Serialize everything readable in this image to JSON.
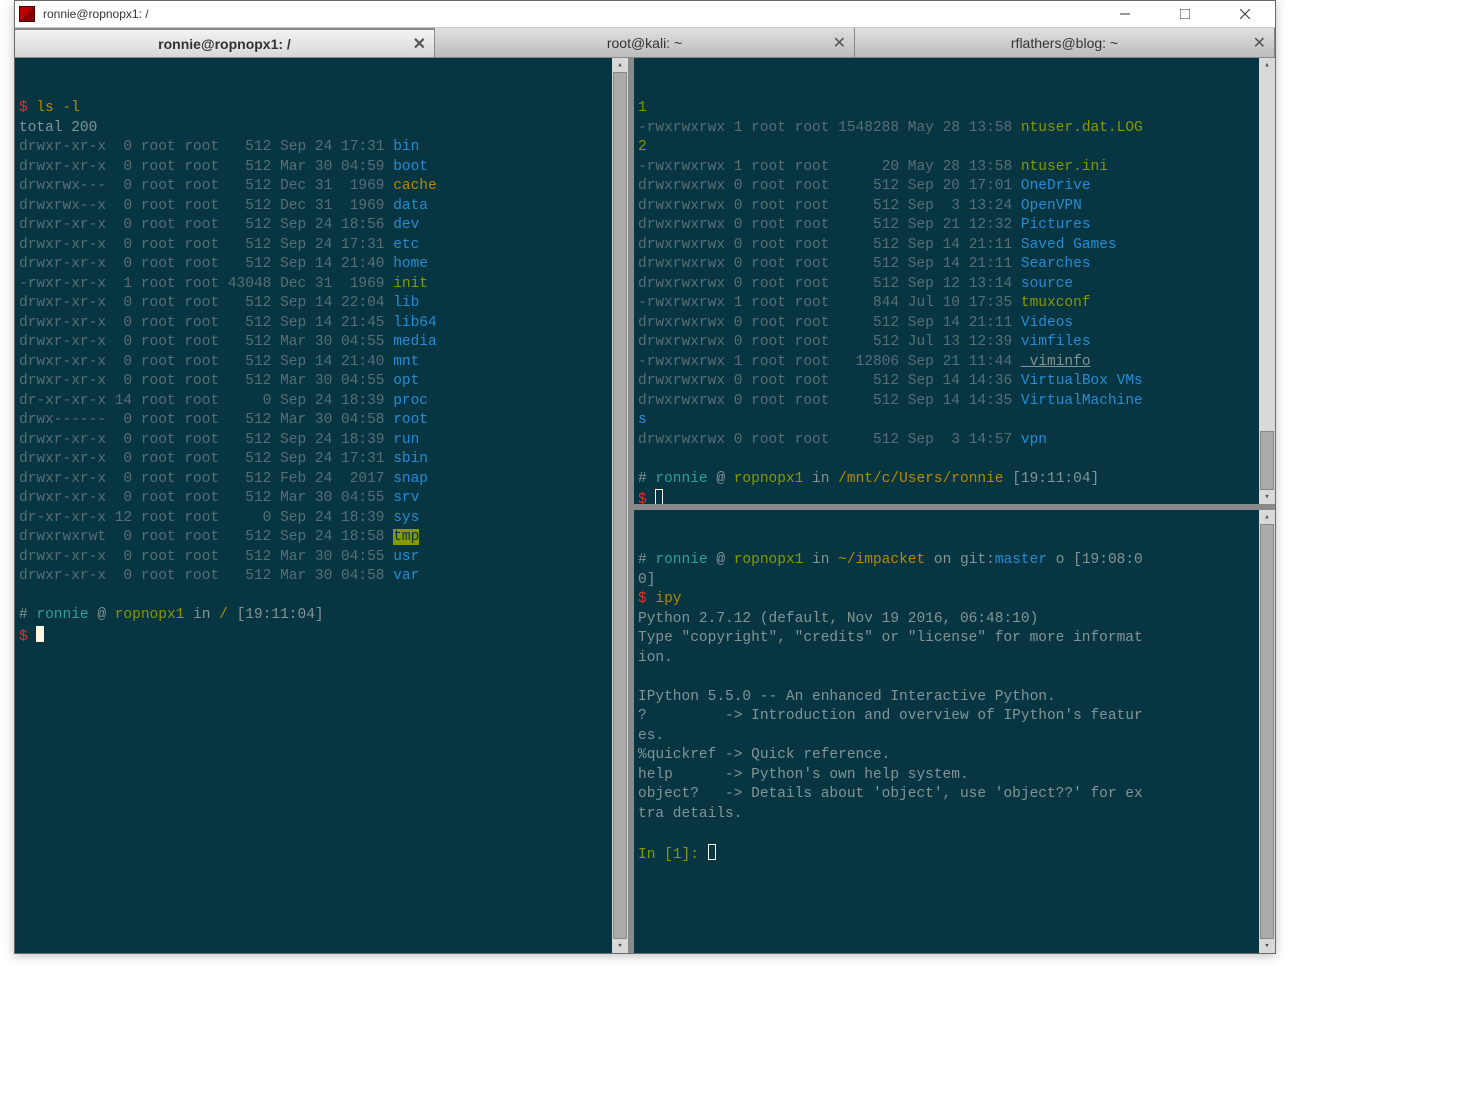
{
  "window": {
    "title": "ronnie@ropnopx1: /"
  },
  "tabs": [
    {
      "label": "ronnie@ropnopx1: /",
      "active": true
    },
    {
      "label": "root@kali: ~",
      "active": false
    },
    {
      "label": "rflathers@blog: ~",
      "active": false
    }
  ],
  "left_pane": {
    "cmd_prompt": "$",
    "cmd": "ls -l",
    "total": "total 200",
    "rows": [
      {
        "perm": "drwxr-xr-x",
        "n": " 0",
        "own": "root root",
        "size": "  512",
        "date": "Sep 24 17:31",
        "name": "bin",
        "cls": "c-dir"
      },
      {
        "perm": "drwxr-xr-x",
        "n": " 0",
        "own": "root root",
        "size": "  512",
        "date": "Mar 30 04:59",
        "name": "boot",
        "cls": "c-dir"
      },
      {
        "perm": "drwxrwx---",
        "n": " 0",
        "own": "root root",
        "size": "  512",
        "date": "Dec 31  1969",
        "name": "cache",
        "cls": "c-cmd"
      },
      {
        "perm": "drwxrwx--x",
        "n": " 0",
        "own": "root root",
        "size": "  512",
        "date": "Dec 31  1969",
        "name": "data",
        "cls": "c-dir"
      },
      {
        "perm": "drwxr-xr-x",
        "n": " 0",
        "own": "root root",
        "size": "  512",
        "date": "Sep 24 18:56",
        "name": "dev",
        "cls": "c-dir"
      },
      {
        "perm": "drwxr-xr-x",
        "n": " 0",
        "own": "root root",
        "size": "  512",
        "date": "Sep 24 17:31",
        "name": "etc",
        "cls": "c-dir"
      },
      {
        "perm": "drwxr-xr-x",
        "n": " 0",
        "own": "root root",
        "size": "  512",
        "date": "Sep 14 21:40",
        "name": "home",
        "cls": "c-dir"
      },
      {
        "perm": "-rwxr-xr-x",
        "n": " 1",
        "own": "root root",
        "size": "43048",
        "date": "Dec 31  1969",
        "name": "init",
        "cls": "c-exec"
      },
      {
        "perm": "drwxr-xr-x",
        "n": " 0",
        "own": "root root",
        "size": "  512",
        "date": "Sep 14 22:04",
        "name": "lib",
        "cls": "c-dir"
      },
      {
        "perm": "drwxr-xr-x",
        "n": " 0",
        "own": "root root",
        "size": "  512",
        "date": "Sep 14 21:45",
        "name": "lib64",
        "cls": "c-dir"
      },
      {
        "perm": "drwxr-xr-x",
        "n": " 0",
        "own": "root root",
        "size": "  512",
        "date": "Mar 30 04:55",
        "name": "media",
        "cls": "c-dir"
      },
      {
        "perm": "drwxr-xr-x",
        "n": " 0",
        "own": "root root",
        "size": "  512",
        "date": "Sep 14 21:40",
        "name": "mnt",
        "cls": "c-dir"
      },
      {
        "perm": "drwxr-xr-x",
        "n": " 0",
        "own": "root root",
        "size": "  512",
        "date": "Mar 30 04:55",
        "name": "opt",
        "cls": "c-dir"
      },
      {
        "perm": "dr-xr-xr-x",
        "n": "14",
        "own": "root root",
        "size": "    0",
        "date": "Sep 24 18:39",
        "name": "proc",
        "cls": "c-dir"
      },
      {
        "perm": "drwx------",
        "n": " 0",
        "own": "root root",
        "size": "  512",
        "date": "Mar 30 04:58",
        "name": "root",
        "cls": "c-dir"
      },
      {
        "perm": "drwxr-xr-x",
        "n": " 0",
        "own": "root root",
        "size": "  512",
        "date": "Sep 24 18:39",
        "name": "run",
        "cls": "c-dir"
      },
      {
        "perm": "drwxr-xr-x",
        "n": " 0",
        "own": "root root",
        "size": "  512",
        "date": "Sep 24 17:31",
        "name": "sbin",
        "cls": "c-dir"
      },
      {
        "perm": "drwxr-xr-x",
        "n": " 0",
        "own": "root root",
        "size": "  512",
        "date": "Feb 24  2017",
        "name": "snap",
        "cls": "c-dir"
      },
      {
        "perm": "drwxr-xr-x",
        "n": " 0",
        "own": "root root",
        "size": "  512",
        "date": "Mar 30 04:55",
        "name": "srv",
        "cls": "c-dir"
      },
      {
        "perm": "dr-xr-xr-x",
        "n": "12",
        "own": "root root",
        "size": "    0",
        "date": "Sep 24 18:39",
        "name": "sys",
        "cls": "c-dir"
      },
      {
        "perm": "drwxrwxrwt",
        "n": " 0",
        "own": "root root",
        "size": "  512",
        "date": "Sep 24 18:58",
        "name": "tmp",
        "cls": "c-hl"
      },
      {
        "perm": "drwxr-xr-x",
        "n": " 0",
        "own": "root root",
        "size": "  512",
        "date": "Mar 30 04:55",
        "name": "usr",
        "cls": "c-dir"
      },
      {
        "perm": "drwxr-xr-x",
        "n": " 0",
        "own": "root root",
        "size": "  512",
        "date": "Mar 30 04:58",
        "name": "var",
        "cls": "c-dir"
      }
    ],
    "prompt_line": {
      "hash": "#",
      "user": "ronnie",
      "at": " @ ",
      "host": "ropnopx1",
      "in": " in ",
      "path": "/",
      "time": "[19:11:04]"
    },
    "final_prompt": "$"
  },
  "tr_pane": {
    "first_num": "1",
    "second_num": "2",
    "rows": [
      {
        "perm": "-rwxrwxrwx",
        "n": "1",
        "own": "root root",
        "size": "1548288",
        "date": "May 28 13:58",
        "name": "ntuser.dat.LOG",
        "cls": "c-exec",
        "wrap": true
      },
      {
        "perm": "-rwxrwxrwx",
        "n": "1",
        "own": "root root",
        "size": "     20",
        "date": "May 28 13:58",
        "name": "ntuser.ini",
        "cls": "c-exec"
      },
      {
        "perm": "drwxrwxrwx",
        "n": "0",
        "own": "root root",
        "size": "    512",
        "date": "Sep 20 17:01",
        "name": "OneDrive",
        "cls": "c-dir"
      },
      {
        "perm": "drwxrwxrwx",
        "n": "0",
        "own": "root root",
        "size": "    512",
        "date": "Sep  3 13:24",
        "name": "OpenVPN",
        "cls": "c-dir"
      },
      {
        "perm": "drwxrwxrwx",
        "n": "0",
        "own": "root root",
        "size": "    512",
        "date": "Sep 21 12:32",
        "name": "Pictures",
        "cls": "c-dir"
      },
      {
        "perm": "drwxrwxrwx",
        "n": "0",
        "own": "root root",
        "size": "    512",
        "date": "Sep 14 21:11",
        "name": "Saved Games",
        "cls": "c-dir"
      },
      {
        "perm": "drwxrwxrwx",
        "n": "0",
        "own": "root root",
        "size": "    512",
        "date": "Sep 14 21:11",
        "name": "Searches",
        "cls": "c-dir"
      },
      {
        "perm": "drwxrwxrwx",
        "n": "0",
        "own": "root root",
        "size": "    512",
        "date": "Sep 12 13:14",
        "name": "source",
        "cls": "c-dir"
      },
      {
        "perm": "-rwxrwxrwx",
        "n": "1",
        "own": "root root",
        "size": "    844",
        "date": "Jul 10 17:35",
        "name": "tmuxconf",
        "cls": "c-exec"
      },
      {
        "perm": "drwxrwxrwx",
        "n": "0",
        "own": "root root",
        "size": "    512",
        "date": "Sep 14 21:11",
        "name": "Videos",
        "cls": "c-dir"
      },
      {
        "perm": "drwxrwxrwx",
        "n": "0",
        "own": "root root",
        "size": "    512",
        "date": "Jul 13 12:39",
        "name": "vimfiles",
        "cls": "c-dir"
      },
      {
        "perm": "-rwxrwxrwx",
        "n": "1",
        "own": "root root",
        "size": "  12806",
        "date": "Sep 21 11:44",
        "name": "_viminfo",
        "cls": "c-uline"
      },
      {
        "perm": "drwxrwxrwx",
        "n": "0",
        "own": "root root",
        "size": "    512",
        "date": "Sep 14 14:36",
        "name": "VirtualBox VMs",
        "cls": "c-dir"
      },
      {
        "perm": "drwxrwxrwx",
        "n": "0",
        "own": "root root",
        "size": "    512",
        "date": "Sep 14 14:35",
        "name": "VirtualMachine",
        "cls": "c-dir",
        "tail": "s"
      },
      {
        "perm": "drwxrwxrwx",
        "n": "0",
        "own": "root root",
        "size": "    512",
        "date": "Sep  3 14:57",
        "name": "vpn",
        "cls": "c-dir",
        "extraspace": true
      }
    ],
    "prompt_line": {
      "hash": "#",
      "user": "ronnie",
      "at": " @ ",
      "host": "ropnopx1",
      "in": " in ",
      "path": "/mnt/c/Users/ronnie",
      "time": "[19:11:04]"
    },
    "final_prompt": "$"
  },
  "br_pane": {
    "prompt_line": {
      "hash": "#",
      "user": "ronnie",
      "at": " @ ",
      "host": "ropnopx1",
      "in": " in ",
      "path": "~/impacket",
      "on": " on ",
      "git": "git:",
      "branch": "master",
      "mark": " o ",
      "time": "[19:08:0",
      "time2": "0]"
    },
    "cmd": "ipy",
    "body": [
      "Python 2.7.12 (default, Nov 19 2016, 06:48:10)",
      "Type \"copyright\", \"credits\" or \"license\" for more informat",
      "ion.",
      "",
      "IPython 5.5.0 -- An enhanced Interactive Python.",
      "?         -> Introduction and overview of IPython's featur",
      "es.",
      "%quickref -> Quick reference.",
      "help      -> Python's own help system.",
      "object?   -> Details about 'object', use 'object??' for ex",
      "tra details."
    ],
    "ipy_prompt": "In [1]: "
  }
}
